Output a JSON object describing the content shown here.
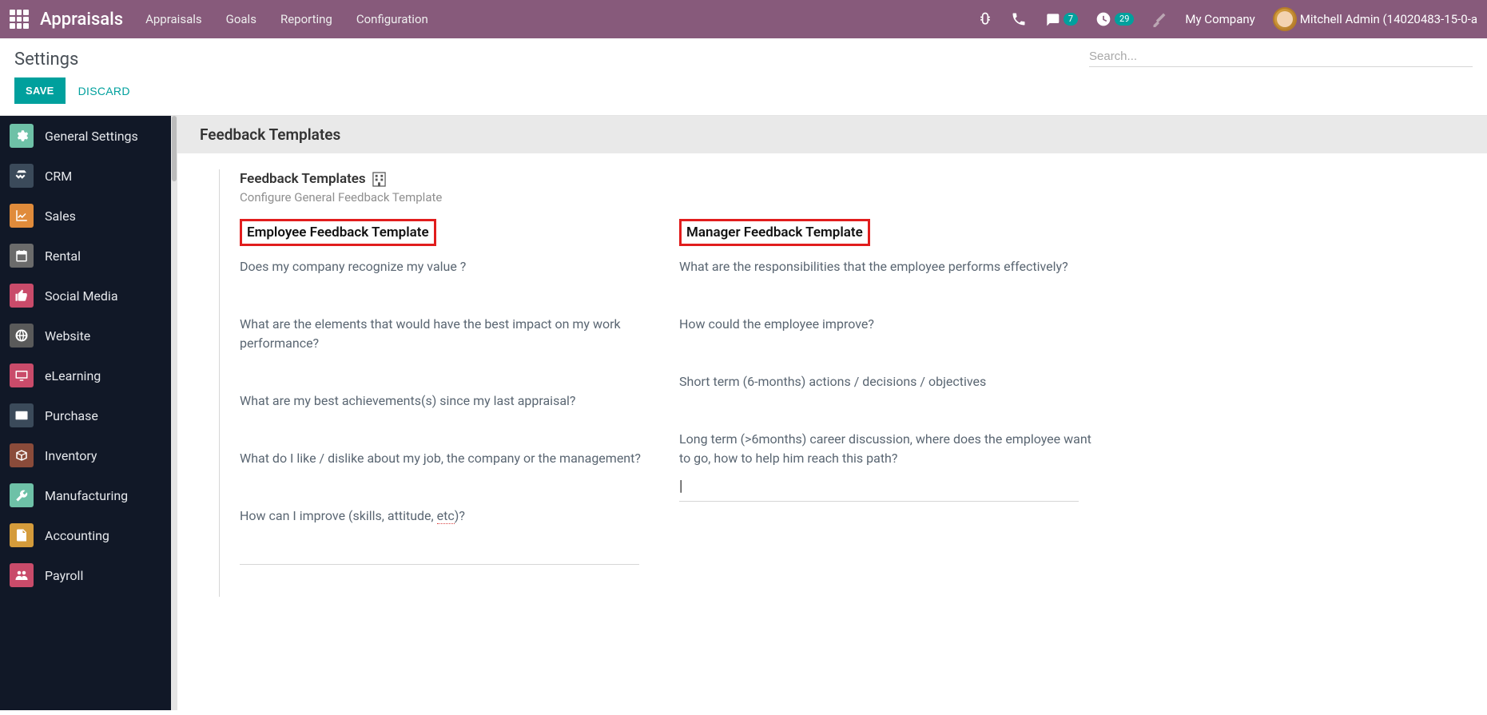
{
  "topbar": {
    "app_title": "Appraisals",
    "menu": [
      "Appraisals",
      "Goals",
      "Reporting",
      "Configuration"
    ],
    "msg_badge": "7",
    "activity_badge": "29",
    "company": "My Company",
    "user": "Mitchell Admin (14020483-15-0-a"
  },
  "control_panel": {
    "title": "Settings",
    "search_placeholder": "Search...",
    "save_label": "SAVE",
    "discard_label": "DISCARD"
  },
  "sidebar": [
    {
      "label": "General Settings",
      "icon": "gear",
      "color": "#6EC1A7"
    },
    {
      "label": "CRM",
      "icon": "hands",
      "color": "#3b4a5a"
    },
    {
      "label": "Sales",
      "icon": "chart",
      "color": "#E08B3B"
    },
    {
      "label": "Rental",
      "icon": "calendar",
      "color": "#6b6b6b"
    },
    {
      "label": "Social Media",
      "icon": "thumb",
      "color": "#C94B6A"
    },
    {
      "label": "Website",
      "icon": "globe",
      "color": "#5a5a5a"
    },
    {
      "label": "eLearning",
      "icon": "monitor",
      "color": "#C94B6A"
    },
    {
      "label": "Purchase",
      "icon": "card",
      "color": "#3b4a5a"
    },
    {
      "label": "Inventory",
      "icon": "box",
      "color": "#8a4b3a"
    },
    {
      "label": "Manufacturing",
      "icon": "wrench",
      "color": "#6EC1A7"
    },
    {
      "label": "Accounting",
      "icon": "invoice",
      "color": "#d49b3b"
    },
    {
      "label": "Payroll",
      "icon": "people",
      "color": "#C94B6A"
    }
  ],
  "section": {
    "header": "Feedback Templates",
    "block_title": "Feedback Templates",
    "block_subtitle": "Configure General Feedback Template",
    "employee": {
      "heading": "Employee Feedback Template",
      "q1": "Does my company recognize my value ?",
      "q2": "What are the elements that would have the best impact on my work performance?",
      "q3": "What are my best achievements(s) since my last appraisal?",
      "q4": "What do I like / dislike about my job, the company or the management?",
      "q5_a": "How can I improve (skills, attitude, ",
      "q5_b": "etc",
      "q5_c": ")?"
    },
    "manager": {
      "heading": "Manager Feedback Template",
      "q1": "What are the responsibilities that the employee performs effectively?",
      "q2": "How could the employee improve?",
      "q3": "Short term (6-months) actions / decisions / objectives",
      "q4": "Long term (>6months) career discussion, where does the employee want to go, how to help him reach this path?"
    }
  }
}
